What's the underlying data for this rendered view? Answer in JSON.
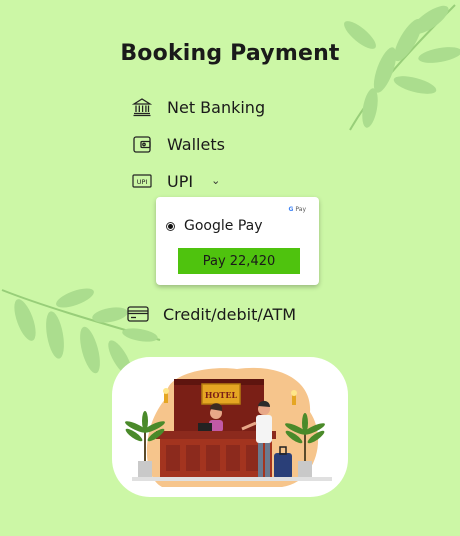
{
  "title": "Booking Payment",
  "methods": {
    "net_banking": {
      "label": "Net Banking",
      "icon": "bank-icon"
    },
    "wallets": {
      "label": "Wallets",
      "icon": "wallet-icon"
    },
    "upi": {
      "label": "UPI",
      "icon": "upi-icon",
      "expand_icon": "chevron-down-icon",
      "icon_text": "UPI"
    },
    "card": {
      "label": "Credit/debit/ATM",
      "icon": "credit-card-icon"
    }
  },
  "upi_panel": {
    "logo_g": "G",
    "logo_text": "Pay",
    "option_label": "Google Pay",
    "selected": true,
    "pay_button": "Pay 22,420"
  },
  "illustration": {
    "sign_text": "HOTEL"
  },
  "colors": {
    "background": "#ccf7a6",
    "pay_button": "#4fc30e",
    "panel": "#ffffff"
  }
}
